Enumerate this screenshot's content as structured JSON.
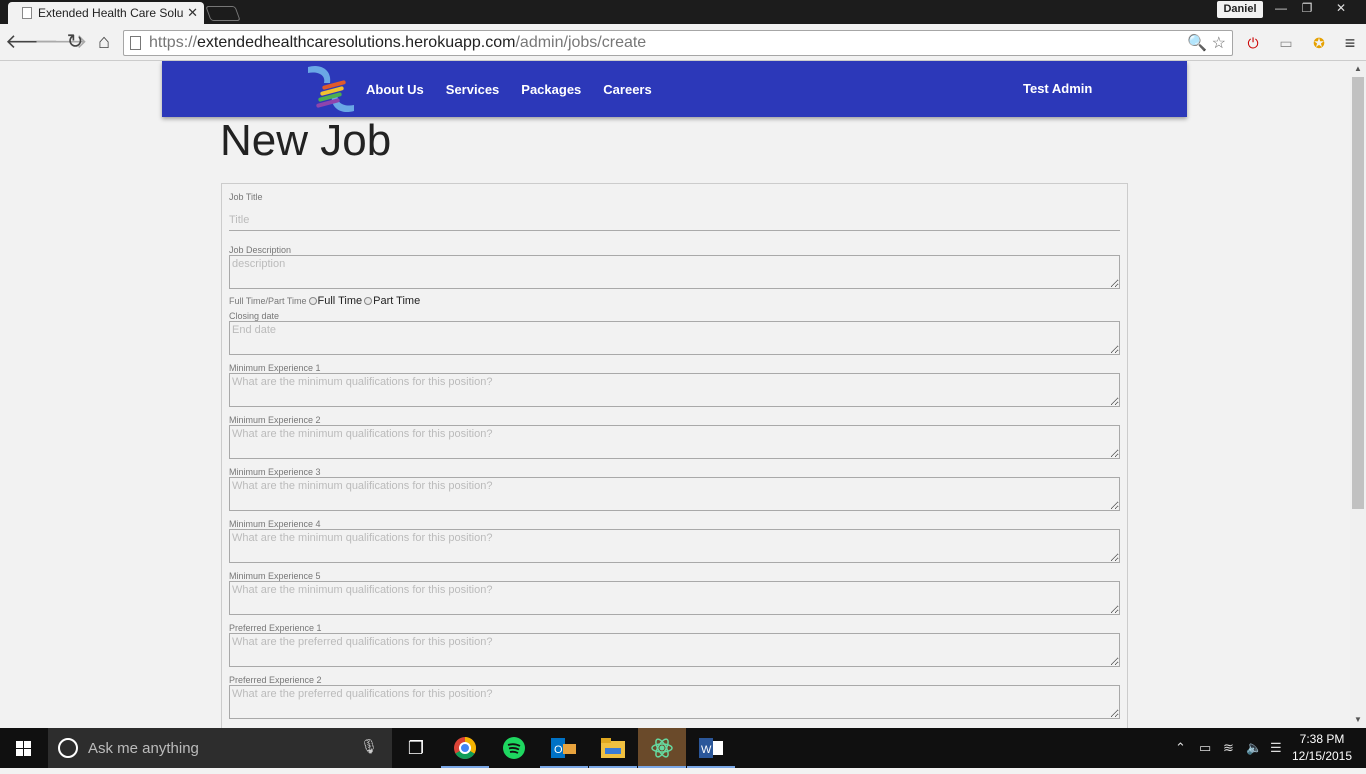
{
  "browser": {
    "tab_title": "Extended Health Care Solu",
    "tab_close": "✕",
    "user": "Daniel",
    "window_controls": {
      "minimize": "—",
      "restore": "❐",
      "close": "✕"
    },
    "url_scheme": "https://",
    "url_host": "extendedhealthcaresolutions.herokuapp.com",
    "url_path": "/admin/jobs/create"
  },
  "header": {
    "nav": [
      "About Us",
      "Services",
      "Packages",
      "Careers"
    ],
    "user": "Test Admin"
  },
  "page": {
    "title": "New Job"
  },
  "form": {
    "job_title": {
      "label": "Job Title",
      "placeholder": "Title"
    },
    "job_description": {
      "label": "Job Description",
      "placeholder": "description"
    },
    "type": {
      "label": "Full Time/Part Time",
      "options": [
        "Full Time",
        "Part Time"
      ]
    },
    "closing_date": {
      "label": "Closing date",
      "placeholder": "End date"
    },
    "min_exp": [
      {
        "label": "Minimum Experience 1",
        "placeholder": "What are the minimum qualifications for this position?"
      },
      {
        "label": "Minimum Experience 2",
        "placeholder": "What are the minimum qualifications for this position?"
      },
      {
        "label": "Minimum Experience 3",
        "placeholder": "What are the minimum qualifications for this position?"
      },
      {
        "label": "Minimum Experience 4",
        "placeholder": "What are the minimum qualifications for this position?"
      },
      {
        "label": "Minimum Experience 5",
        "placeholder": "What are the minimum qualifications for this position?"
      }
    ],
    "pref_exp": [
      {
        "label": "Preferred Experience 1",
        "placeholder": "What are the preferred qualifications for this position?"
      },
      {
        "label": "Preferred Experience 2",
        "placeholder": "What are the preferred qualifications for this position?"
      }
    ]
  },
  "taskbar": {
    "search_placeholder": "Ask me anything",
    "time": "7:38 PM",
    "date": "12/15/2015"
  }
}
